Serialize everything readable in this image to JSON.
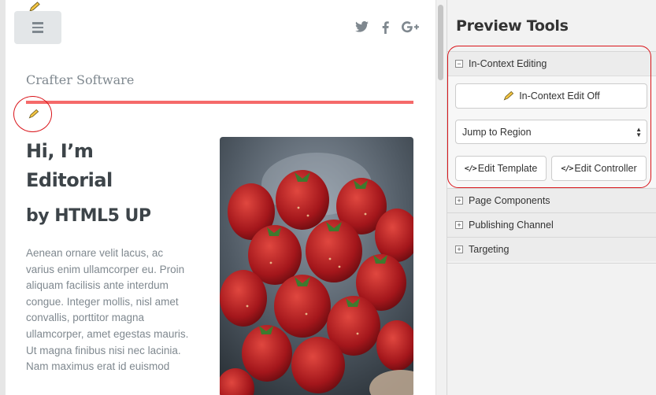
{
  "preview": {
    "site_name": "Crafter Software",
    "hero_title": "Hi, I’m Editorial",
    "hero_subtitle": "by HTML5 UP",
    "hero_body": "Aenean ornare velit lacus, ac varius enim ullamcorper eu. Proin aliquam facilisis ante interdum congue. Integer mollis, nisl amet convallis, porttitor magna ullamcorper, amet egestas mauris. Ut magna finibus nisi nec lacinia. Nam maximus erat id euismod",
    "social_icons": [
      "twitter-icon",
      "facebook-icon",
      "google-plus-icon"
    ],
    "accent_color": "#f56a6a"
  },
  "tools": {
    "title": "Preview Tools",
    "sections": [
      {
        "label": "In-Context Editing",
        "expanded": true
      },
      {
        "label": "Page Components",
        "expanded": false
      },
      {
        "label": "Publishing Channel",
        "expanded": false
      },
      {
        "label": "Targeting",
        "expanded": false
      }
    ],
    "edit_toggle_label": "In-Context Edit Off",
    "region_select": {
      "selected": "Jump to Region"
    },
    "edit_template_label": "Edit Template",
    "edit_controller_label": "Edit Controller",
    "annotation_color": "#d9141a"
  }
}
